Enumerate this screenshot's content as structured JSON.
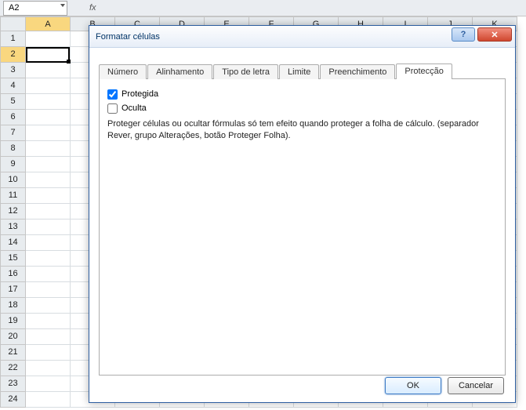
{
  "formula_bar": {
    "name_box_value": "A2",
    "fx_label": "fx"
  },
  "grid": {
    "columns": [
      "A",
      "B",
      "C",
      "D",
      "E",
      "F",
      "G",
      "H",
      "I",
      "J",
      "K"
    ],
    "rows": [
      "1",
      "2",
      "3",
      "4",
      "5",
      "6",
      "7",
      "8",
      "9",
      "10",
      "11",
      "12",
      "13",
      "14",
      "15",
      "16",
      "17",
      "18",
      "19",
      "20",
      "21",
      "22",
      "23",
      "24"
    ],
    "selected_col": "A",
    "selected_row": "2",
    "active_cell": "A2"
  },
  "dialog": {
    "title": "Formatar células",
    "tabs": {
      "numero": "Número",
      "alinhamento": "Alinhamento",
      "tipo_de_letra": "Tipo de letra",
      "limite": "Limite",
      "preenchimento": "Preenchimento",
      "proteccao": "Protecção"
    },
    "active_tab": "proteccao",
    "proteccao_panel": {
      "protegida_label": "Protegida",
      "protegida_checked": true,
      "oculta_label": "Oculta",
      "oculta_checked": false,
      "description": "Proteger células ou ocultar fórmulas só tem efeito quando proteger a folha de cálculo. (separador Rever, grupo Alterações, botão Proteger Folha)."
    },
    "buttons": {
      "ok": "OK",
      "cancel": "Cancelar"
    },
    "window_buttons": {
      "help": "?",
      "close": "✕"
    }
  }
}
